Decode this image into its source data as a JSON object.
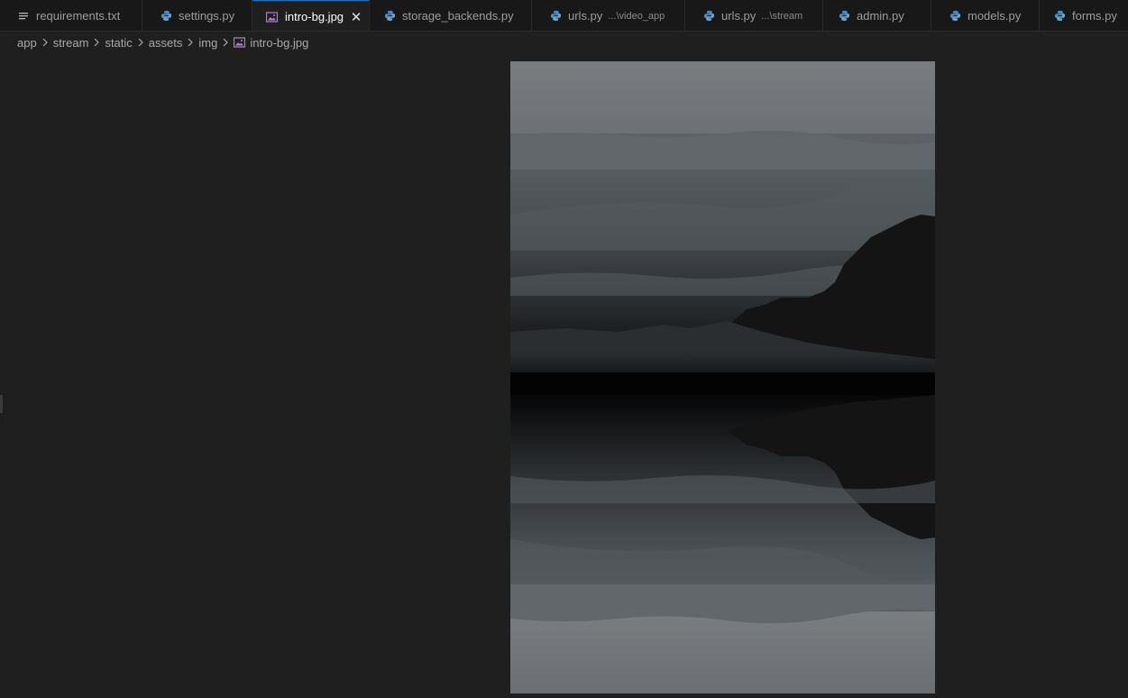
{
  "tabs": [
    {
      "label": "requirements.txt",
      "icon": "text-file-icon",
      "description": "",
      "active": false
    },
    {
      "label": "settings.py",
      "icon": "python-icon",
      "description": "",
      "active": false
    },
    {
      "label": "intro-bg.jpg",
      "icon": "image-file-icon",
      "description": "",
      "active": true
    },
    {
      "label": "storage_backends.py",
      "icon": "python-icon",
      "description": "",
      "active": false
    },
    {
      "label": "urls.py",
      "icon": "python-icon",
      "description": "...\\video_app",
      "active": false
    },
    {
      "label": "urls.py",
      "icon": "python-icon",
      "description": "...\\stream",
      "active": false
    },
    {
      "label": "admin.py",
      "icon": "python-icon",
      "description": "",
      "active": false
    },
    {
      "label": "models.py",
      "icon": "python-icon",
      "description": "",
      "active": false
    },
    {
      "label": "forms.py",
      "icon": "python-icon",
      "description": "",
      "active": false
    }
  ],
  "close_glyph": "✕",
  "breadcrumb": {
    "segments": [
      "app",
      "stream",
      "static",
      "assets",
      "img"
    ],
    "file": "intro-bg.jpg"
  },
  "colors": {
    "accent": "#0078d4",
    "python_icon": "#4b8bbe",
    "image_icon": "#b180d7",
    "background": "#1f1f1f"
  }
}
